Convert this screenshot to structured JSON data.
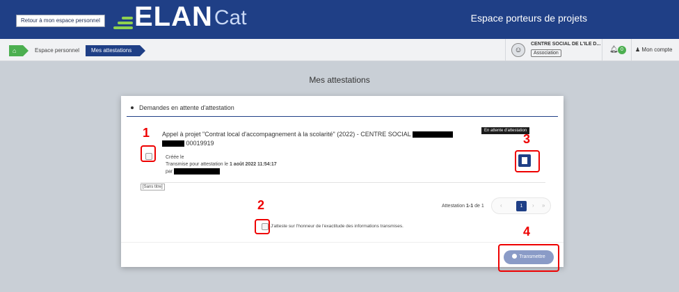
{
  "header": {
    "back_button": "Retour à mon espace personnel",
    "logo_main": "ELAN",
    "logo_suffix": "Cat",
    "title": "Espace porteurs de projets"
  },
  "breadcrumb": {
    "home_icon": "home-icon",
    "items": [
      "Espace personnel",
      "Mes attestations"
    ]
  },
  "account_bar": {
    "org_name": "CENTRE SOCIAL DE L'ILE D...",
    "org_type": "Association",
    "notifications": "0",
    "account_label": "Mon compte"
  },
  "page": {
    "title": "Mes attestations"
  },
  "section": {
    "heading": "Demandes en attente d'attestation"
  },
  "item": {
    "title": "Appel à projet \"Contrat local d'accompagnement à la scolarité\" (2022) - CENTRE SOCIAL",
    "ref_suffix": "00019919",
    "status": "En attente d'attestation",
    "created_label": "Créée le",
    "transmitted_prefix": "Transmise pour attestation le",
    "transmitted_date": "1 août 2022 11:54:17",
    "by_label": "par",
    "tag": "[Sans titre]"
  },
  "pagination": {
    "prefix": "Attestation",
    "range": "1-1",
    "of": "de 1",
    "current_page": "1"
  },
  "attestation": {
    "text": "J'atteste sur l'honneur de l'exactitude des informations transmises."
  },
  "actions": {
    "submit": "Transmettre"
  },
  "annotations": [
    "1",
    "2",
    "3",
    "4"
  ],
  "colors": {
    "primary": "#1f3f86",
    "accent": "#4caf50",
    "annotation": "#e00000"
  }
}
